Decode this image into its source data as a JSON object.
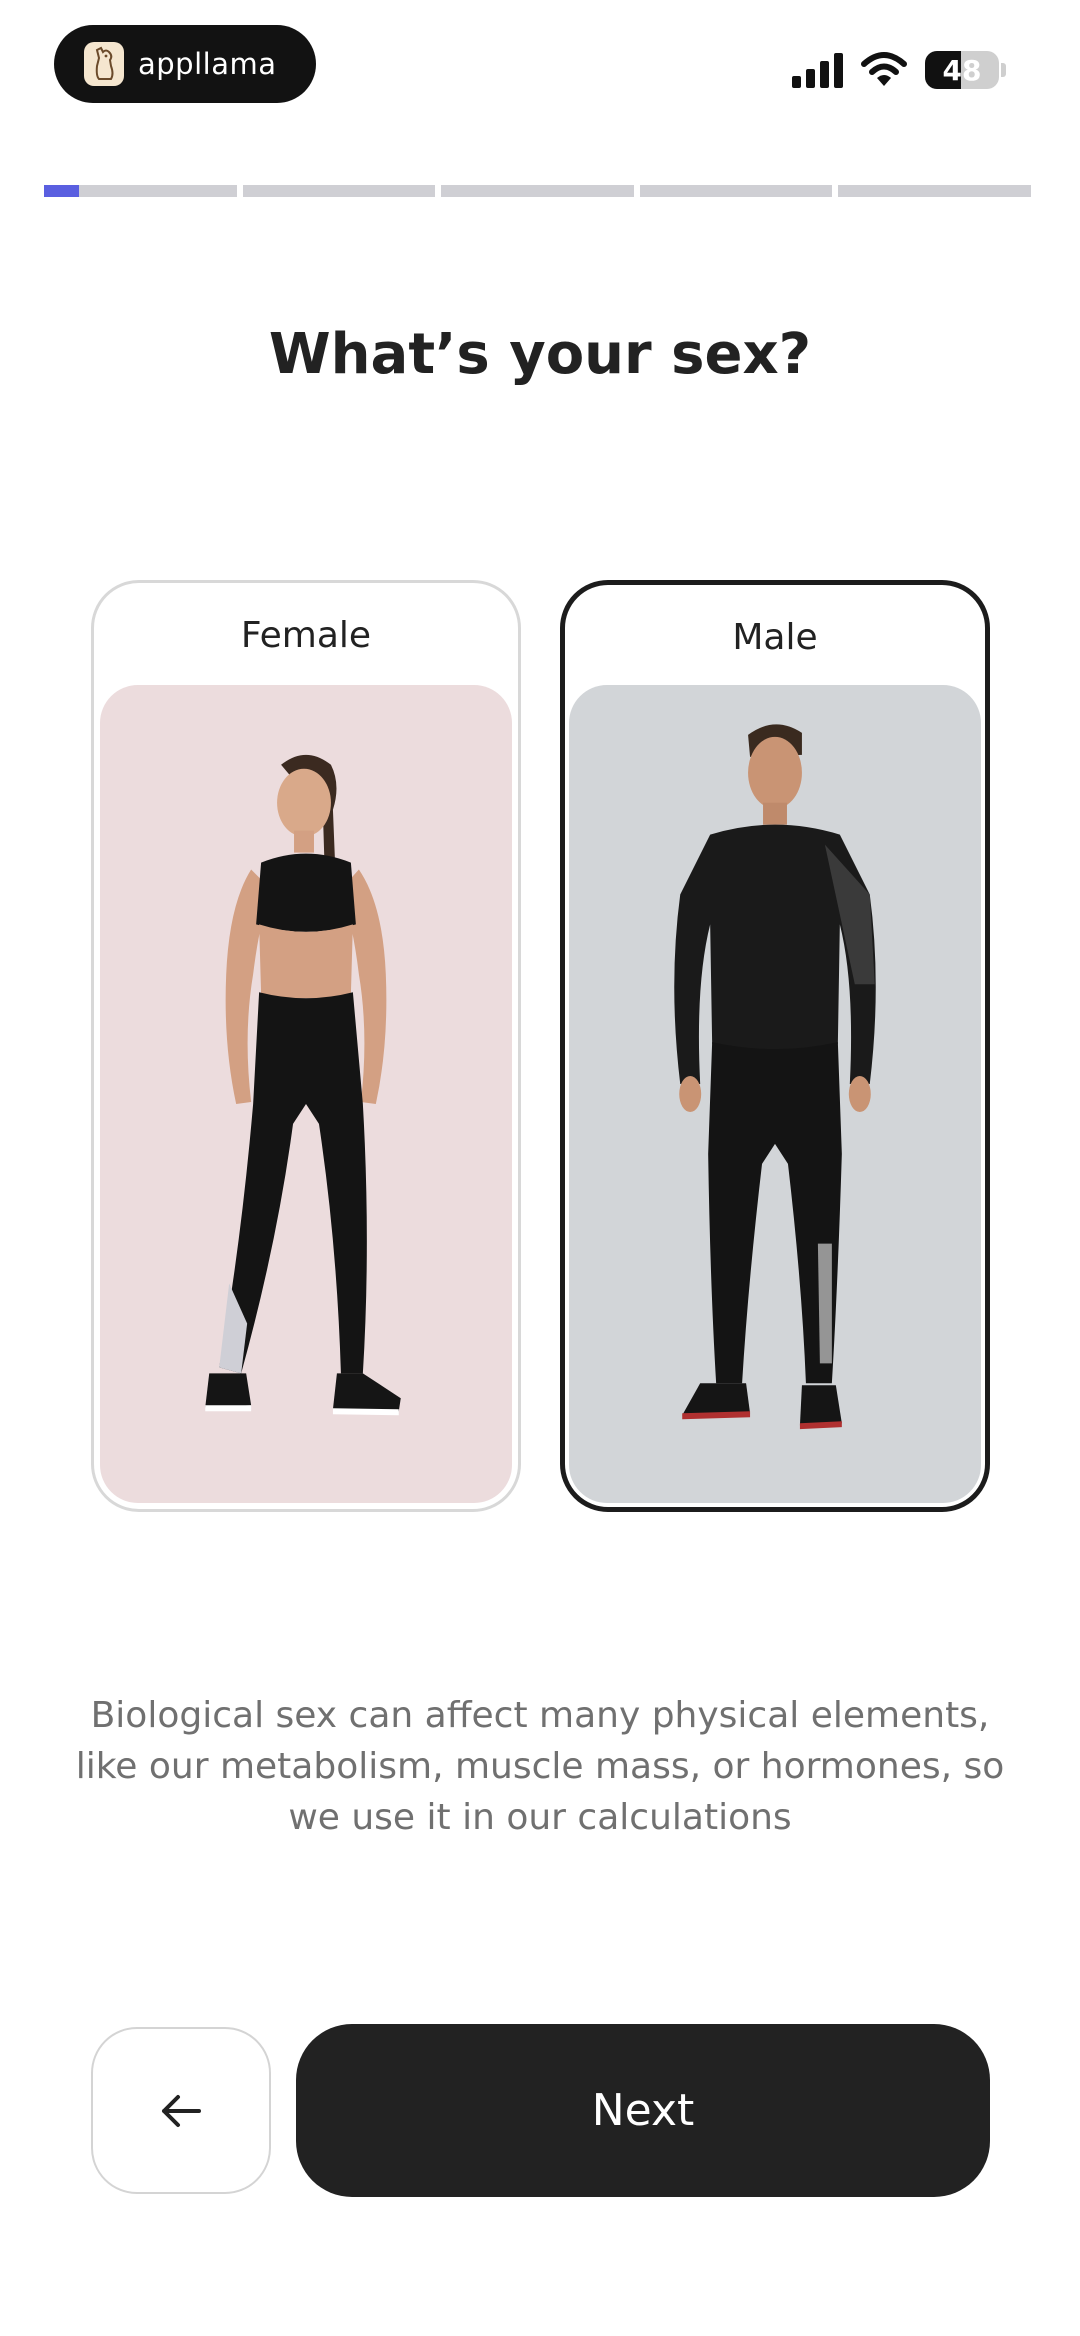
{
  "status_bar": {
    "brand_name": "appllama",
    "battery_percent": "48",
    "icons": [
      "signal-icon",
      "wifi-icon",
      "battery-icon"
    ]
  },
  "progress": {
    "segments": 5,
    "current_segment": 1,
    "current_fill": 0.18,
    "accent_color": "#5a5fe0"
  },
  "question": {
    "title": "What’s your sex?"
  },
  "options": [
    {
      "label": "Female",
      "selected": false,
      "photo_bg": "#ecdcdd"
    },
    {
      "label": "Male",
      "selected": true,
      "photo_bg": "#d2d5d8"
    }
  ],
  "info": {
    "text": "Biological sex can affect many physical elements, like our metabolism, muscle mass, or hormones, so we use it in our calculations"
  },
  "footer": {
    "back_icon": "arrow-left-icon",
    "next_label": "Next"
  }
}
